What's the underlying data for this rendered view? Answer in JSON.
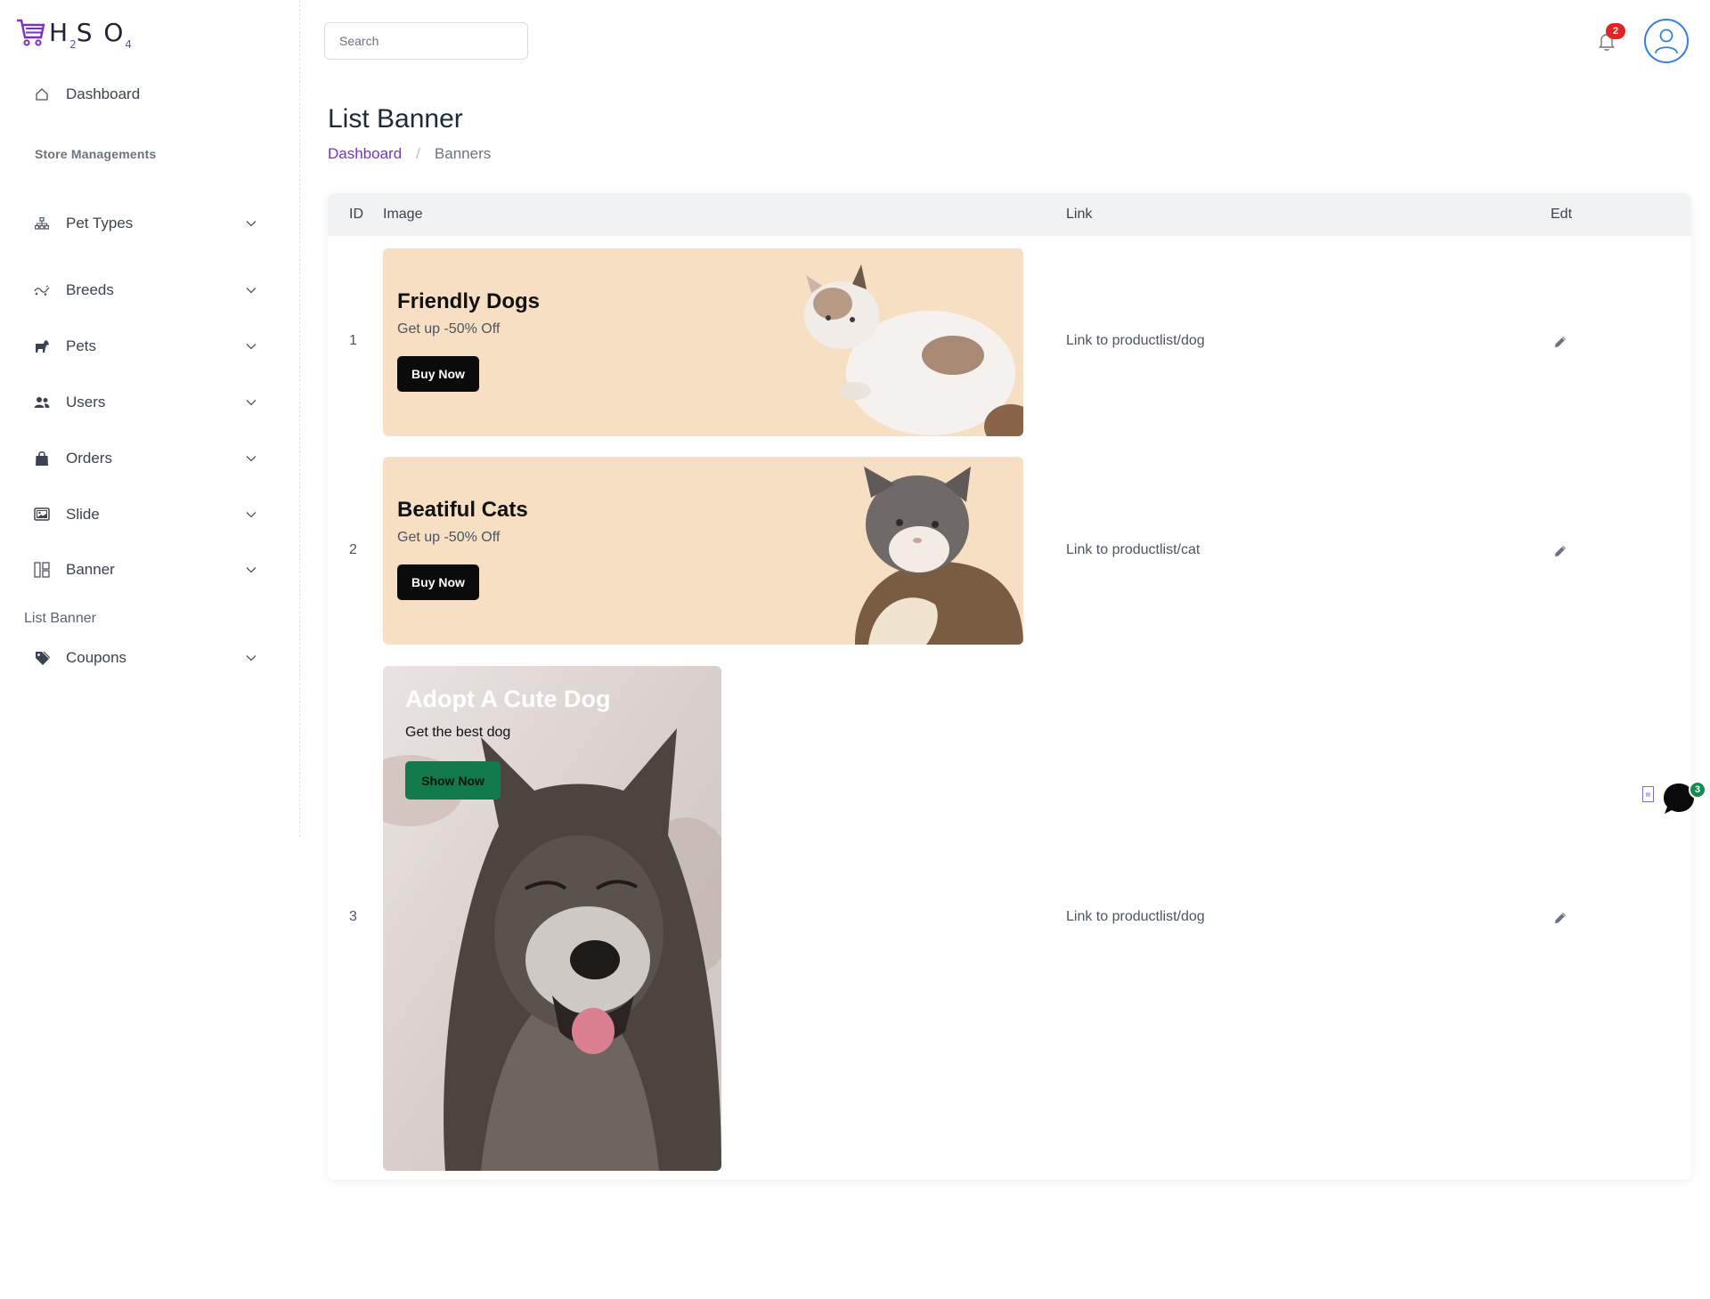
{
  "app": {
    "logo_text": "H",
    "logo_sub_2": "2",
    "logo_mid": "S O",
    "logo_sub_4": "4",
    "accent_color": "#7b2fd1"
  },
  "sidebar": {
    "dashboard": "Dashboard",
    "section_heading": "Store Managements",
    "items": [
      {
        "label": "Pet Types",
        "icon": "sitemap-icon"
      },
      {
        "label": "Breeds",
        "icon": "breed-icon"
      },
      {
        "label": "Pets",
        "icon": "dog-icon"
      },
      {
        "label": "Users",
        "icon": "users-icon"
      },
      {
        "label": "Orders",
        "icon": "shopping-bag-icon"
      },
      {
        "label": "Slide",
        "icon": "image-icon"
      },
      {
        "label": "Banner",
        "icon": "layout-icon"
      },
      {
        "label": "Coupons",
        "icon": "tag-icon"
      }
    ],
    "list_banner": "List Banner"
  },
  "header": {
    "search_placeholder": "Search",
    "notification_count": "2"
  },
  "page": {
    "title": "List Banner",
    "breadcrumb_home": "Dashboard",
    "breadcrumb_sep": "/",
    "breadcrumb_current": "Banners"
  },
  "table": {
    "headers": {
      "id": "ID",
      "image": "Image",
      "link": "Link",
      "edit": "Edt"
    },
    "rows": [
      {
        "id": "1",
        "title": "Friendly Dogs",
        "subtitle": "Get up -50% Off",
        "button": "Buy Now",
        "link": "Link to productlist/dog"
      },
      {
        "id": "2",
        "title": "Beatiful Cats",
        "subtitle": "Get up -50% Off",
        "button": "Buy Now",
        "link": "Link to productlist/cat"
      },
      {
        "id": "3",
        "title": "Adopt A Cute Dog",
        "subtitle": "Get the best dog",
        "button": "Show Now",
        "link": "Link to productlist/dog"
      }
    ]
  },
  "chat": {
    "unread_count": "3"
  }
}
